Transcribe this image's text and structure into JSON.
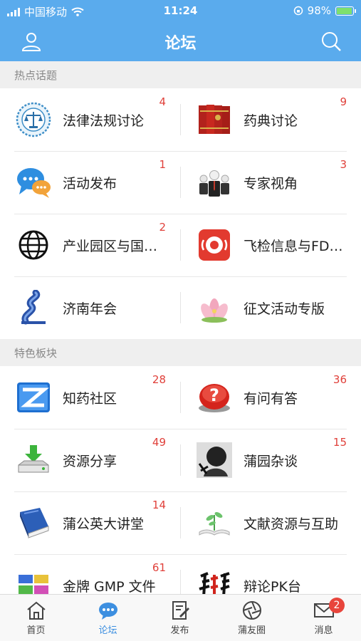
{
  "status_bar": {
    "carrier": "中国移动",
    "time": "11:24",
    "battery": "98%"
  },
  "header": {
    "title": "论坛"
  },
  "sections": [
    {
      "title": "热点话题",
      "items": [
        {
          "label": "法律法规讨论",
          "count": "4",
          "icon": "scales-emblem-icon"
        },
        {
          "label": "药典讨论",
          "count": "9",
          "icon": "pharmacopoeia-books-icon"
        },
        {
          "label": "活动发布",
          "count": "1",
          "icon": "chat-bubbles-icon"
        },
        {
          "label": "专家视角",
          "count": "3",
          "icon": "business-people-icon"
        },
        {
          "label": "产业园区与国…",
          "count": "2",
          "icon": "globe-icon"
        },
        {
          "label": "飞检信息与FD…",
          "count": "",
          "icon": "alarm-icon"
        },
        {
          "label": "济南年会",
          "count": "",
          "icon": "spring-sculpture-icon"
        },
        {
          "label": "征文活动专版",
          "count": "",
          "icon": "lotus-icon"
        }
      ]
    },
    {
      "title": "特色板块",
      "items": [
        {
          "label": "知药社区",
          "count": "28",
          "icon": "z-logo-icon"
        },
        {
          "label": "有问有答",
          "count": "36",
          "icon": "question-button-icon"
        },
        {
          "label": "资源分享",
          "count": "49",
          "icon": "download-drive-icon"
        },
        {
          "label": "蒲园杂谈",
          "count": "15",
          "icon": "ink-portrait-icon"
        },
        {
          "label": "蒲公英大讲堂",
          "count": "14",
          "icon": "blue-book-icon"
        },
        {
          "label": "文献资源与互助",
          "count": "",
          "icon": "open-book-sprout-icon"
        },
        {
          "label": "金牌 GMP 文件",
          "count": "61",
          "icon": "colored-files-icon"
        },
        {
          "label": "辩论PK台",
          "count": "",
          "icon": "debate-calligraphy-icon"
        }
      ]
    }
  ],
  "tabbar": {
    "tabs": [
      {
        "label": "首页"
      },
      {
        "label": "论坛"
      },
      {
        "label": "发布"
      },
      {
        "label": "蒲友圈"
      },
      {
        "label": "消息",
        "badge": "2"
      }
    ]
  }
}
